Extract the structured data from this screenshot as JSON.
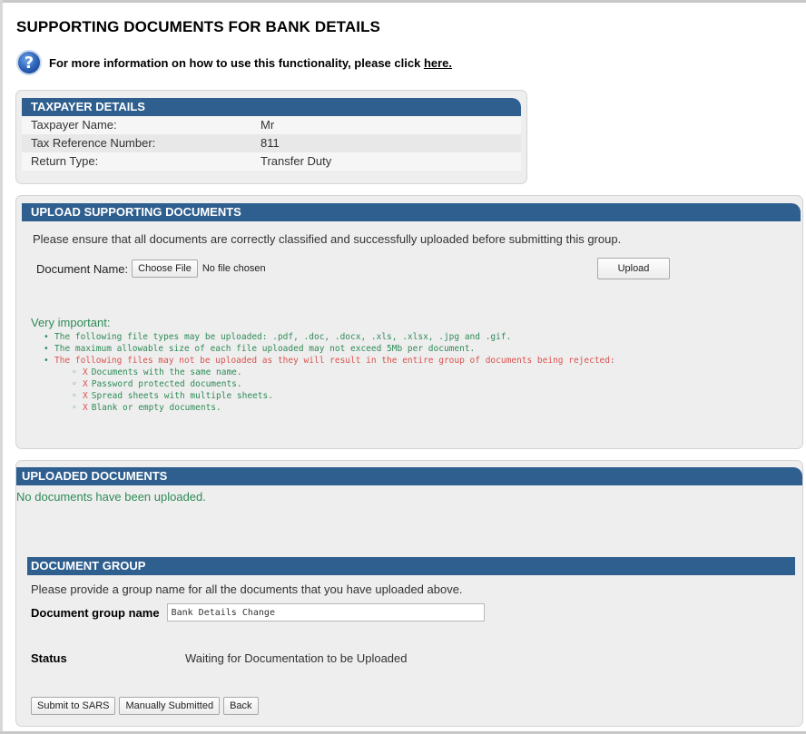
{
  "page": {
    "title": "SUPPORTING DOCUMENTS FOR BANK DETAILS",
    "help_text": "For more information on how to use this functionality, please click",
    "help_link": "here."
  },
  "taxpayer": {
    "header": "TAXPAYER DETAILS",
    "rows": [
      {
        "label": "Taxpayer Name:",
        "value": "Mr"
      },
      {
        "label": "Tax Reference Number:",
        "value": "811"
      },
      {
        "label": "Return Type:",
        "value": "Transfer Duty"
      }
    ]
  },
  "upload": {
    "header": "UPLOAD SUPPORTING DOCUMENTS",
    "instruction": "Please ensure that all documents are correctly classified and successfully uploaded before submitting this group.",
    "document_name_label": "Document Name:",
    "choose_file_label": "Choose File",
    "file_status": "No file chosen",
    "upload_button": "Upload"
  },
  "very_important": {
    "title": "Very important:",
    "items": [
      {
        "text": "The following file types may be uploaded: .pdf, .doc, .docx, .xls, .xlsx, .jpg and .gif.",
        "color": "#2e8b57"
      },
      {
        "text": "The maximum allowable size of each file uploaded may not exceed 5Mb per document.",
        "color": "#2e8b57"
      },
      {
        "text": "The following files may not be uploaded as they will result in the entire group of documents being rejected:",
        "color": "#d9534f"
      }
    ],
    "rejections": [
      {
        "x": "X",
        "text": "Documents with the same name."
      },
      {
        "x": "X",
        "text": "Password protected documents."
      },
      {
        "x": "X",
        "text": "Spread sheets with multiple sheets."
      },
      {
        "x": "X",
        "text": "Blank or empty documents."
      }
    ]
  },
  "uploaded": {
    "header": "UPLOADED DOCUMENTS",
    "empty_message": "No documents have been uploaded."
  },
  "group": {
    "header": "DOCUMENT GROUP",
    "instruction": "Please provide a group name for all the documents that you have uploaded above.",
    "name_label": "Document group name",
    "name_value": "Bank Details Change",
    "status_label": "Status",
    "status_value": "Waiting for Documentation to be Uploaded"
  },
  "actions": {
    "submit": "Submit to SARS",
    "manual": "Manually Submitted",
    "back": "Back"
  },
  "colors": {
    "header_blue": "#2f5f8f",
    "success_green": "#2e8b57",
    "warning_red": "#d9534f"
  },
  "icons": {
    "help": "question-mark-circle-icon"
  }
}
